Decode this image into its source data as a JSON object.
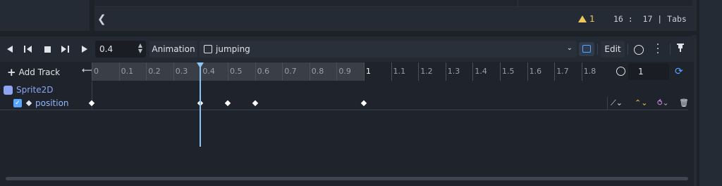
{
  "status_bar": {
    "collapse_glyph": "❮",
    "warning_count": "1",
    "cursor_position": "16 :  17 | Tabs"
  },
  "toolbar": {
    "buttons": [
      "play-backwards-from-end",
      "play-backwards",
      "stop",
      "play-from-start",
      "play"
    ],
    "position_value": "0.4",
    "animation_label": "Animation",
    "animation_name": "jumping",
    "edit_label": "Edit"
  },
  "timeline": {
    "add_track_label": "Add Track",
    "ticks": [
      "0",
      "0.1",
      "0.2",
      "0.3",
      "0.4",
      "0.5",
      "0.6",
      "0.7",
      "0.8",
      "0.9",
      "1",
      "1.1",
      "1.2",
      "1.3",
      "1.4",
      "1.5",
      "1.6",
      "1.7",
      "1.8"
    ],
    "animation_length": 1,
    "playhead_time": 0.4,
    "step_value": "1"
  },
  "tracks": {
    "node_name": "Sprite2D",
    "property": "position",
    "keyframe_times": [
      0,
      0.4,
      0.5,
      0.6,
      1.0
    ]
  },
  "colors": {
    "accent": "#58a6ff",
    "node": "#8da5f3",
    "warning": "#f0c85a",
    "playhead": "#8cc3f5"
  }
}
